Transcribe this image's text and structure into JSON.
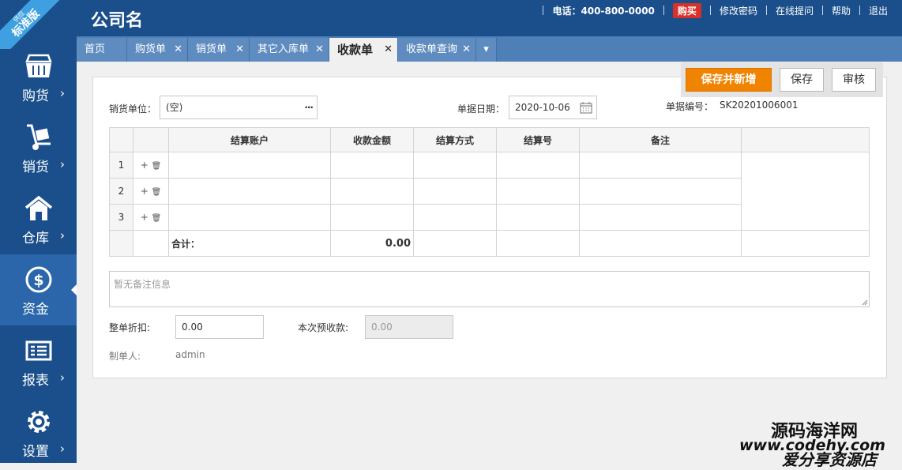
{
  "ribbon": {
    "small": "供应",
    "large": "标准版"
  },
  "sidebar": {
    "items": [
      {
        "label": "购货",
        "icon": "basket-icon",
        "caret": "›"
      },
      {
        "label": "销货",
        "icon": "hand-truck-icon",
        "caret": "›"
      },
      {
        "label": "仓库",
        "icon": "warehouse-icon",
        "caret": "›"
      },
      {
        "label": "资金",
        "icon": "dollar-coin-icon",
        "caret": "›"
      },
      {
        "label": "报表",
        "icon": "report-icon",
        "caret": "›"
      },
      {
        "label": "设置",
        "icon": "gear-icon",
        "caret": "›"
      }
    ],
    "active_index": 3
  },
  "header": {
    "company": "公司名",
    "phone": "电话：400-800-0000",
    "buy": "购买",
    "change_password": "修改密码",
    "online_question": "在线提问",
    "help": "帮助",
    "logout": "退出"
  },
  "tabs": [
    {
      "label": "首页",
      "closable": false
    },
    {
      "label": "购货单",
      "closable": true
    },
    {
      "label": "销货单",
      "closable": true
    },
    {
      "label": "其它入库单",
      "closable": true
    },
    {
      "label": "收款单",
      "closable": true,
      "active": true
    },
    {
      "label": "收款单查询",
      "closable": true
    }
  ],
  "tab_close": "✕",
  "tab_more": "▾",
  "toolbar": {
    "save_new": "保存并新增",
    "save": "保存",
    "audit": "审核"
  },
  "form": {
    "seller_label": "销货单位：",
    "seller_value": "(空)",
    "seller_more": "···",
    "date_label": "单据日期：",
    "date_value": "2020-10-06",
    "number_label": "单据编号：",
    "number_value": "SK20201006001"
  },
  "grid": {
    "headers": [
      "结算账户",
      "收款金额",
      "结算方式",
      "结算号",
      "备注"
    ],
    "rows": [
      "1",
      "2",
      "3"
    ],
    "add_op": "+",
    "delete_op": "🗑",
    "sum_label": "合计：",
    "sum_value": "0.00"
  },
  "note": {
    "placeholder": "暂无备注信息"
  },
  "footer": {
    "discount_label": "整单折扣:",
    "discount_value": "0.00",
    "prepaid_label": "本次预收款:",
    "prepaid_value": "0.00",
    "maker_label": "制单人:",
    "maker_value": "admin"
  },
  "watermark": {
    "line1": "源码海洋网",
    "line2": "www.codehy.com",
    "line3": "爱分享资源店"
  },
  "colors": {
    "sidebar": "#1a4f8b",
    "active_nav": "#2a66a9",
    "tabbar": "#4f7fb7",
    "primary_button": "#f08300",
    "buy_badge": "#d9302a"
  }
}
